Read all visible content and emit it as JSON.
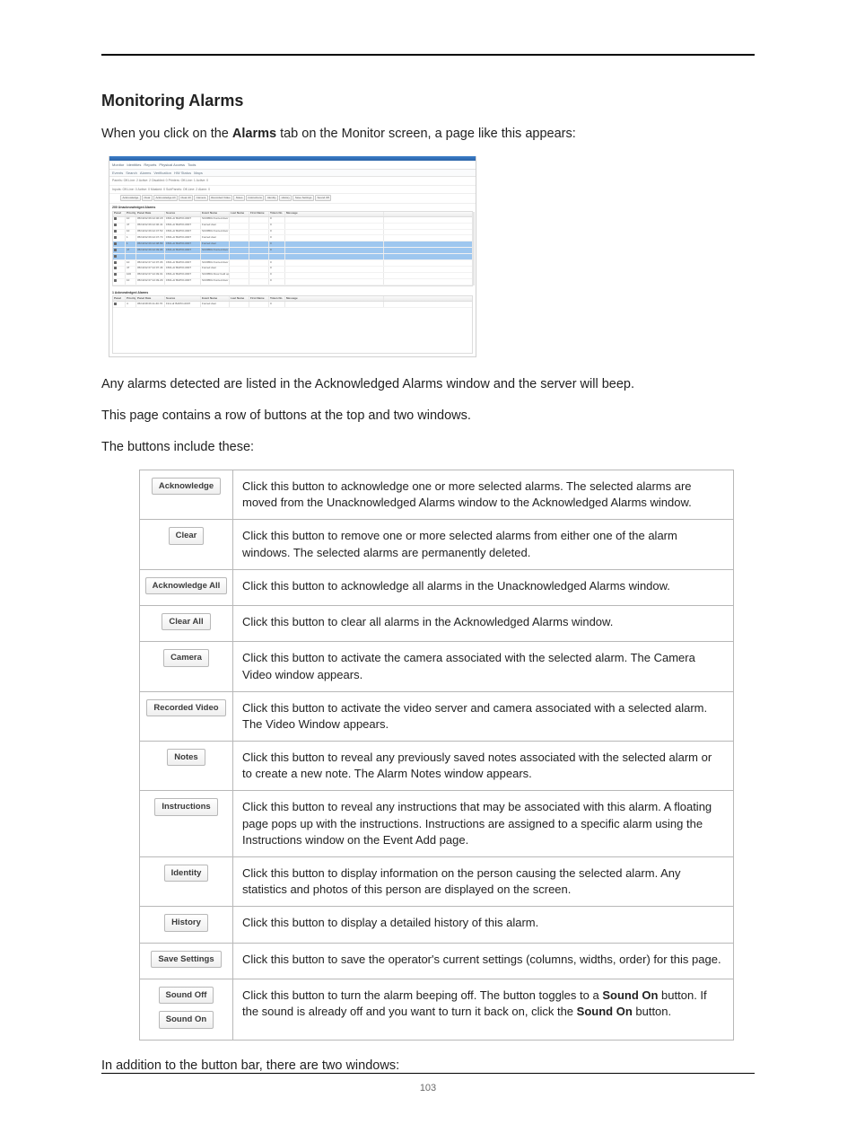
{
  "page_number": "103",
  "heading": "Monitoring Alarms",
  "intro_before": "When you click on the ",
  "intro_bold": "Alarms",
  "intro_after": " tab on the Monitor screen, a page like this appears:",
  "para2": "Any alarms detected are listed in the Acknowledged Alarms window and the server will beep.",
  "para3": "This page contains a row of buttons at the top and two windows.",
  "para4": "The buttons include these:",
  "closing": "In addition to the button bar, there are two windows:",
  "shot": {
    "top_tabs": [
      "Monitor",
      "Identities",
      "Reports",
      "Physical Access",
      "Tools"
    ],
    "sub_tabs": [
      "Events",
      "Search",
      "Alarms",
      "Verification",
      "HW Status",
      "Maps"
    ],
    "status_left": "Panels: Off-Line: 2  Active: 2  Disabled: 0         Printers: Off-Line: 1  Active: 0",
    "status_left2": "Inputs: Off-Line: 0  Active: 0  Masked: 0        SubPanels: Off-Line: 2  Alarm: 0",
    "buttons": [
      "Acknowledge",
      "Clear",
      "Acknowledge All",
      "Clear All",
      "Camera",
      "Recorded Video",
      "Notes",
      "Instructions",
      "Identity",
      "History",
      "Save Settings",
      "Sound Off"
    ],
    "section1": "200 Unacknowledged Alarms",
    "section2": "1 Acknowledged Alarms",
    "columns": [
      "Panel",
      "Priority",
      "Panel Date",
      "Source",
      "Event Name",
      "Last Name",
      "First Name",
      "Token No",
      "Message"
    ],
    "rows": [
      {
        "panel": "",
        "pri": "10",
        "date": "05/10/12 09:12:46.18",
        "src": "1501-dr BAPIO-0007",
        "evt": "SC0950c Forced door",
        "ln": "",
        "fn": "",
        "tok": "0",
        "msg": ""
      },
      {
        "panel": "",
        "pri": "47",
        "date": "05/10/12 09:12:46.41",
        "src": "1501-dr BAPIO-0007",
        "evt": "Forced door",
        "ln": "",
        "fn": "",
        "tok": "0",
        "msg": ""
      },
      {
        "panel": "",
        "pri": "10",
        "date": "05/10/12 09:12:47.53",
        "src": "1501-dr BAPIO-0007",
        "evt": "SC0950c Forced door",
        "ln": "",
        "fn": "",
        "tok": "0",
        "msg": ""
      },
      {
        "panel": "",
        "pri": "1",
        "date": "05/10/12 09:12:47.73",
        "src": "1501-dr BAPIO-0007",
        "evt": "Forced door",
        "ln": "",
        "fn": "",
        "tok": "0",
        "msg": ""
      },
      {
        "panel": "",
        "pri": "1",
        "date": "05/10/12 09:12:48.89",
        "src": "1501-dr BAPIO-0007",
        "evt": "Forced door",
        "ln": "",
        "fn": "",
        "tok": "0",
        "msg": "",
        "hl": true
      },
      {
        "panel": "",
        "pri": "47",
        "date": "05/10/12 09:12:49.06",
        "src": "1501-dr BAPIO-0007",
        "evt": "SC0950c Forced door",
        "ln": "",
        "fn": "",
        "tok": "0",
        "msg": "",
        "hl": true
      },
      {
        "panel": "",
        "pri": "",
        "date": "",
        "src": "",
        "evt": "",
        "ln": "",
        "fn": "",
        "tok": "",
        "msg": "",
        "hl": true
      },
      {
        "panel": "",
        "pri": "10",
        "date": "05/10/12 07:12:07.06",
        "src": "1501-dr BAPIO-0007",
        "evt": "SC0950c Forced door",
        "ln": "",
        "fn": "",
        "tok": "0",
        "msg": ""
      },
      {
        "panel": "",
        "pri": "47",
        "date": "05/10/12 07:12:07.46",
        "src": "1501-dr BAPIO-0007",
        "evt": "Forced door",
        "ln": "",
        "fn": "",
        "tok": "0",
        "msg": ""
      },
      {
        "panel": "",
        "pri": "100",
        "date": "05/10/12 07:12:49.01",
        "src": "1501-dr BAPIO-0007",
        "evt": "SC0950c Door held open",
        "ln": "",
        "fn": "",
        "tok": "0",
        "msg": ""
      },
      {
        "panel": "",
        "pri": "10",
        "date": "05/10/12 07:12:49.29",
        "src": "1501-dr BAPIO-0007",
        "evt": "SC0950c Forced door",
        "ln": "",
        "fn": "",
        "tok": "0",
        "msg": ""
      }
    ],
    "rows2": [
      {
        "panel": "",
        "pri": "4",
        "date": "05/10/18 06:11:40.76",
        "src": "First-dr BAPIO-0007",
        "evt": "Forced door",
        "ln": "",
        "fn": "",
        "tok": "0",
        "msg": ""
      }
    ]
  },
  "buttons_table": [
    {
      "labels": [
        "Acknowledge"
      ],
      "desc": "Click this button to acknowledge one or more selected alarms. The selected alarms are moved from the Unacknowledged Alarms window to the Acknowledged Alarms window."
    },
    {
      "labels": [
        "Clear"
      ],
      "desc": "Click this button to remove one or more selected alarms from either one of the alarm windows. The selected alarms are permanently deleted."
    },
    {
      "labels": [
        "Acknowledge All"
      ],
      "desc": "Click this button to acknowledge all alarms in the Unacknowledged Alarms window."
    },
    {
      "labels": [
        "Clear All"
      ],
      "desc": "Click this button to clear all alarms in the Acknowledged Alarms window."
    },
    {
      "labels": [
        "Camera"
      ],
      "desc": "Click this button to activate the camera associated with the selected alarm. The Camera Video window appears."
    },
    {
      "labels": [
        "Recorded Video"
      ],
      "desc": "Click this button to activate the video server and camera associated with a selected alarm. The Video Window appears."
    },
    {
      "labels": [
        "Notes"
      ],
      "desc": "Click this button to reveal any previously saved notes associated with the selected alarm or to create a new note. The Alarm Notes window appears."
    },
    {
      "labels": [
        "Instructions"
      ],
      "desc": "Click this button to reveal any instructions that may be associated with this alarm. A floating page pops up with the instructions. Instructions are assigned to a specific alarm using the Instructions window on the Event Add page."
    },
    {
      "labels": [
        "Identity"
      ],
      "desc": "Click this button to display information on the person causing the selected alarm. Any statistics and photos of this person are displayed on the screen."
    },
    {
      "labels": [
        "History"
      ],
      "desc": "Click this button to display a detailed history of this alarm."
    },
    {
      "labels": [
        "Save Settings"
      ],
      "desc": "Click this button to save the operator's current settings (columns, widths, order) for this page."
    },
    {
      "labels": [
        "Sound Off",
        "Sound On"
      ],
      "desc_html": true,
      "desc_p1": "Click this button to turn the alarm beeping off. The button toggles to a ",
      "desc_b1": "Sound On",
      "desc_p2": " button. If the sound is already off and you want to turn it back on, click the ",
      "desc_b2": "Sound On",
      "desc_p3": " button."
    }
  ]
}
